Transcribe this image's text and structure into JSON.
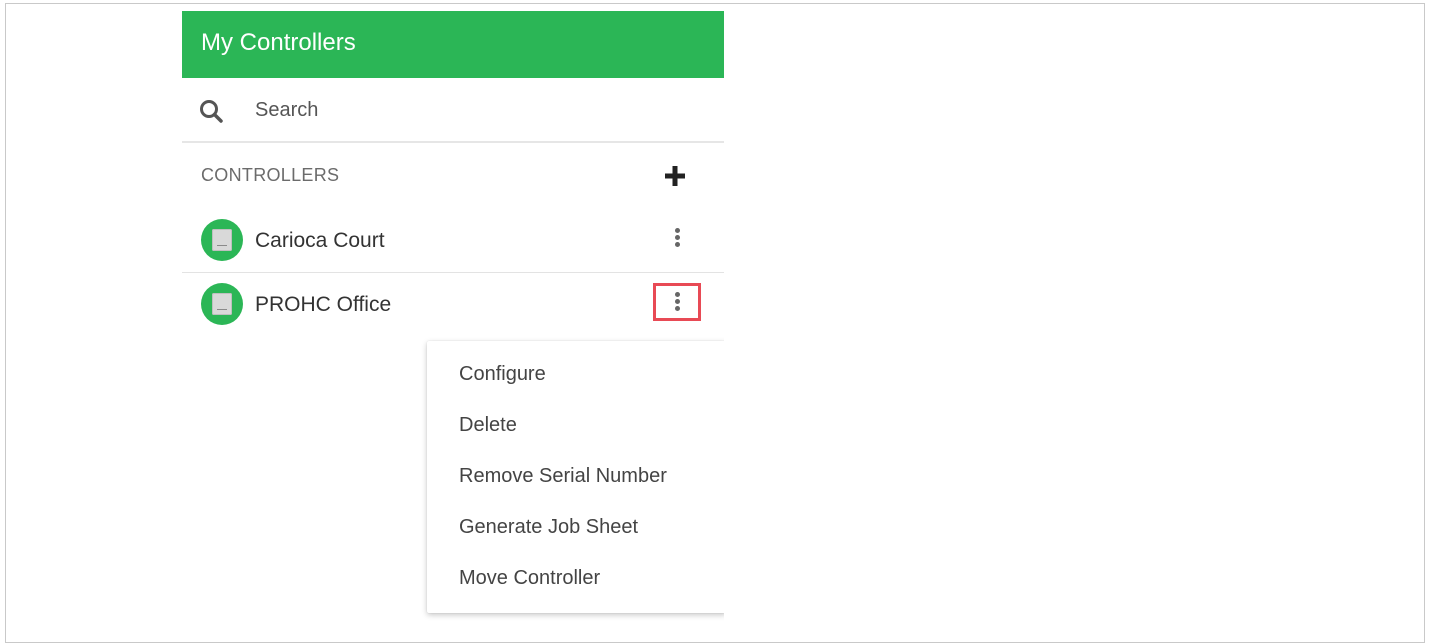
{
  "header": {
    "title": "My Controllers"
  },
  "search": {
    "placeholder": "Search"
  },
  "section": {
    "label": "CONTROLLERS"
  },
  "controllers": [
    {
      "name": "Carioca Court"
    },
    {
      "name": "PROHC Office"
    }
  ],
  "menu": {
    "items": [
      {
        "label": "Configure"
      },
      {
        "label": "Delete"
      },
      {
        "label": "Remove Serial Number"
      },
      {
        "label": "Generate Job Sheet"
      },
      {
        "label": "Move Controller"
      }
    ]
  },
  "colors": {
    "brand_green": "#2bb656",
    "highlight_red": "#e84a55"
  }
}
